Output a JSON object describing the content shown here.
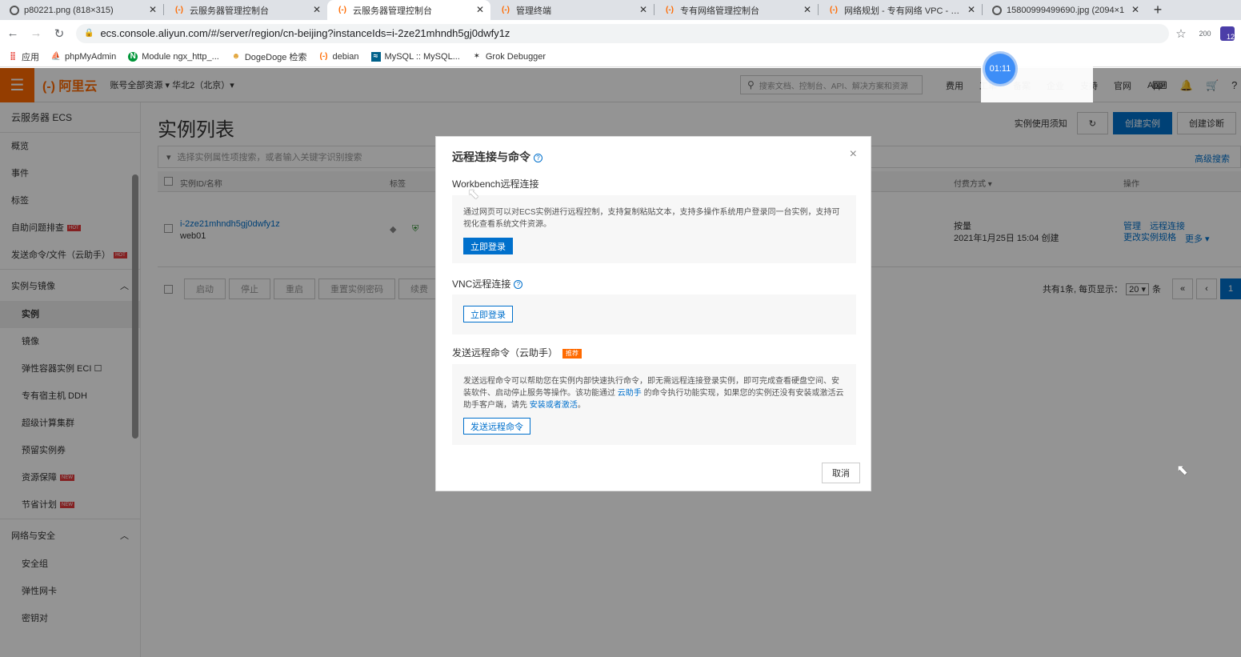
{
  "browser": {
    "tabs": [
      {
        "title": "p80221.png (818×315)",
        "favicon": "globe-icon",
        "active": false
      },
      {
        "title": "云服务器管理控制台",
        "favicon": "aliyun-icon",
        "active": false
      },
      {
        "title": "云服务器管理控制台",
        "favicon": "aliyun-icon",
        "active": true
      },
      {
        "title": "管理终端",
        "favicon": "aliyun-icon",
        "active": false
      },
      {
        "title": "专有网络管理控制台",
        "favicon": "aliyun-icon",
        "active": false
      },
      {
        "title": "网络规划 - 专有网络 VPC - 阿里",
        "favicon": "aliyun-icon",
        "active": false
      },
      {
        "title": "15800999499690.jpg (2094×1",
        "favicon": "globe-icon",
        "active": false
      }
    ],
    "close_glyph": "✕",
    "new_tab_glyph": "+",
    "url": "ecs.console.aliyun.com/#/server/region/cn-beijing?instanceIds=i-2ze21mhndh5gj0dwfy1z",
    "ext_count": "200",
    "ext_badge": "12",
    "bookmarks": [
      {
        "label": "应用",
        "icon": "apps-grid-icon",
        "color": "#e8453c"
      },
      {
        "label": "phpMyAdmin",
        "icon": "phpmyadmin-icon",
        "color": "#f29111"
      },
      {
        "label": "Module ngx_http_...",
        "icon": "nginx-icon",
        "color": "#009639"
      },
      {
        "label": "DogeDoge 检索",
        "icon": "dogedoge-icon",
        "color": "#e0a030"
      },
      {
        "label": "debian",
        "icon": "aliyun-icon",
        "color": "#ff6a00"
      },
      {
        "label": "MySQL :: MySQL...",
        "icon": "mysql-icon",
        "color": "#00618a"
      },
      {
        "label": "Grok Debugger",
        "icon": "grok-icon",
        "color": "#333333"
      }
    ]
  },
  "console": {
    "logo": "(-) 阿里云",
    "account": "账号全部资源 ▾  华北2（北京）▾",
    "search_placeholder": "搜索文档、控制台、API、解决方案和资源",
    "top_links": [
      "费用",
      "工单",
      "备案",
      "企业",
      "支持",
      "官网",
      "App"
    ],
    "sidebar": {
      "title": "云服务器 ECS",
      "items": [
        {
          "label": "概览",
          "badge": ""
        },
        {
          "label": "事件",
          "badge": ""
        },
        {
          "label": "标签",
          "badge": ""
        },
        {
          "label": "自助问题排查",
          "badge": "HOT"
        },
        {
          "label": "发送命令/文件（云助手）",
          "badge": "HOT"
        }
      ],
      "group1": "实例与镜像",
      "group1_items": [
        {
          "label": "实例",
          "badge": "",
          "active": true
        },
        {
          "label": "镜像",
          "badge": ""
        },
        {
          "label": "弹性容器实例 ECI ☐",
          "badge": ""
        },
        {
          "label": "专有宿主机 DDH",
          "badge": ""
        },
        {
          "label": "超级计算集群",
          "badge": ""
        },
        {
          "label": "预留实例券",
          "badge": ""
        },
        {
          "label": "资源保障",
          "badge": "NEW"
        },
        {
          "label": "节省计划",
          "badge": "NEW"
        }
      ],
      "group2": "网络与安全",
      "group2_items": [
        {
          "label": "安全组"
        },
        {
          "label": "弹性网卡"
        },
        {
          "label": "密钥对"
        }
      ]
    },
    "main": {
      "title": "实例列表",
      "usage_link": "实例使用须知",
      "create_instance": "创建实例",
      "create_diag": "创建诊断",
      "filter_placeholder": "选择实例属性项搜索，或者输入关键字识别搜索",
      "adv_search": "高级搜索",
      "headers": {
        "id": "实例ID/名称",
        "tag": "标签",
        "billing": "付费方式 ▾",
        "ops": "操作"
      },
      "row": {
        "id": "i-2ze21mhndh5gj0dwfy1z",
        "name": "web01",
        "billing": "按量",
        "created": "2021年1月25日 15:04 创建",
        "op1": "管理",
        "op2": "远程连接",
        "op3": "更改实例规格",
        "op4": "更多 ▾"
      },
      "bottom_buttons": [
        "启动",
        "停止",
        "重启",
        "重置实例密码",
        "续费"
      ],
      "pager_text": "共有1条, 每页显示：",
      "page_size": "20 ▾",
      "pager_unit": "条",
      "pager_prev_first": "«",
      "pager_prev": "‹",
      "current_page": "1"
    }
  },
  "timer": "01:11",
  "dialog": {
    "title": "远程连接与命令",
    "help_glyph": "?",
    "close_glyph": "×",
    "workbench": {
      "title": "Workbench远程连接",
      "desc": "通过网页可以对ECS实例进行远程控制，支持复制粘贴文本，支持多操作系统用户登录同一台实例，支持可视化查看系统文件资源。",
      "button": "立即登录"
    },
    "vnc": {
      "title": "VNC远程连接",
      "button": "立即登录"
    },
    "command": {
      "title": "发送远程命令（云助手）",
      "tag": "推荐",
      "desc_part1": "发送远程命令可以帮助您在实例内部快速执行命令，即无需远程连接登录实例，即可完成查看硬盘空间、安装软件、启动停止服务等操作。该功能通过",
      "desc_link1": "云助手",
      "desc_part2": "的命令执行功能实现，如果您的实例还没有安装或激活云助手客户端，请先",
      "desc_link2": "安装或者激活",
      "desc_part3": "。",
      "button": "发送远程命令"
    },
    "cancel": "取消"
  }
}
